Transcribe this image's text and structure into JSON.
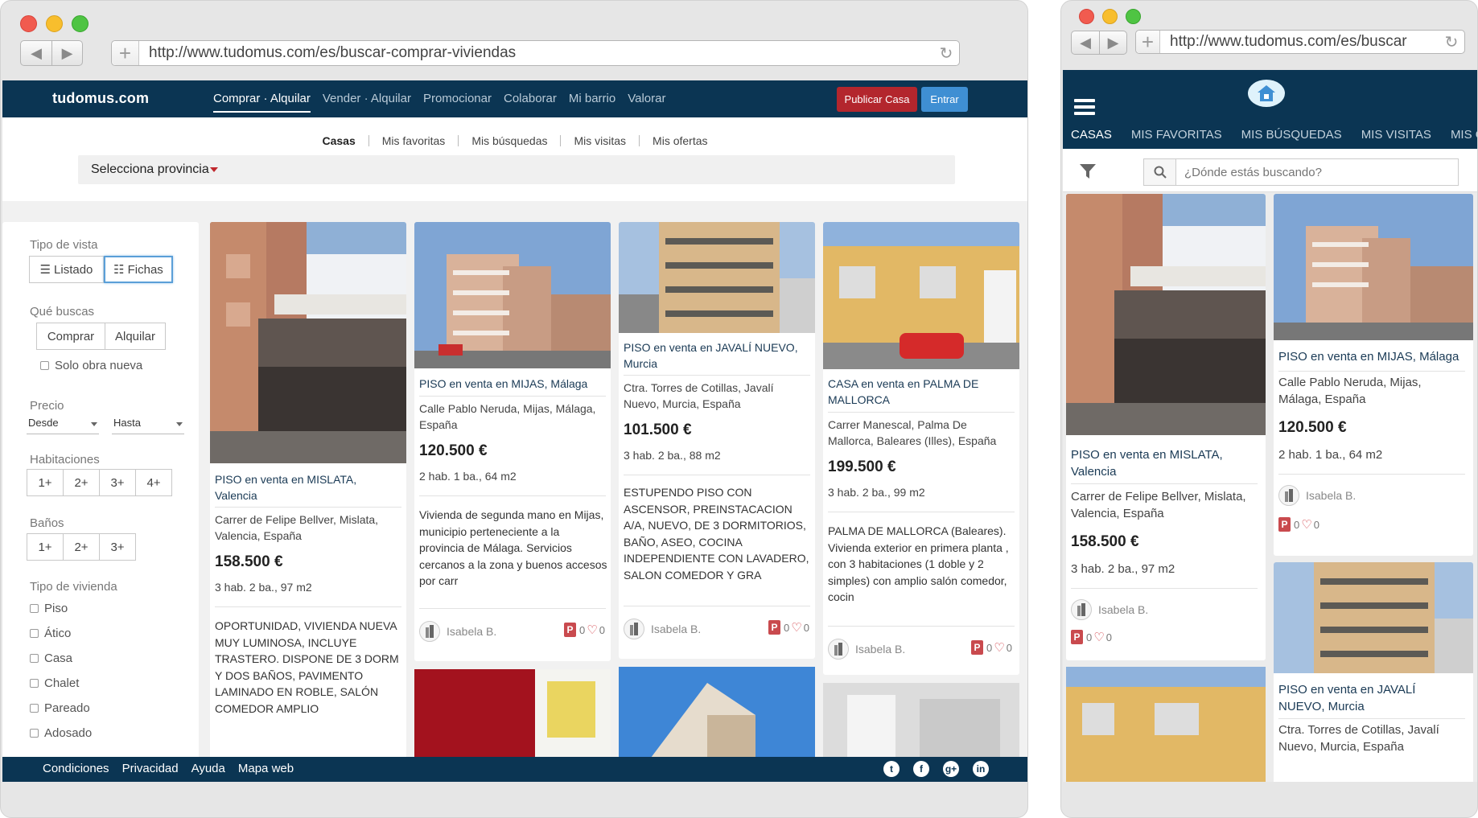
{
  "main_window": {
    "url": "http://www.tudomus.com/es/buscar-comprar-viviendas",
    "site": {
      "logo": "tudomus.com",
      "nav": [
        "Comprar · Alquilar",
        "Vender · Alquilar",
        "Promocionar",
        "Colaborar",
        "Mi barrio",
        "Valorar"
      ],
      "publish_label": "Publicar Casa",
      "login_label": "Entrar",
      "subnav": [
        "Casas",
        "Mis favoritas",
        "Mis búsquedas",
        "Mis visitas",
        "Mis ofertas"
      ],
      "province_label": "Selecciona provincia"
    },
    "filters": {
      "view_type_title": "Tipo de vista",
      "view_list": "Listado",
      "view_cards": "Fichas",
      "looking_title": "Qué buscas",
      "buy": "Comprar",
      "rent": "Alquilar",
      "new_only": "Solo obra nueva",
      "price_title": "Precio",
      "price_from": "Desde",
      "price_to": "Hasta",
      "rooms_title": "Habitaciones",
      "rooms": [
        "1+",
        "2+",
        "3+",
        "4+"
      ],
      "baths_title": "Baños",
      "baths": [
        "1+",
        "2+",
        "3+"
      ],
      "type_title": "Tipo de vivienda",
      "types": [
        "Piso",
        "Ático",
        "Casa",
        "Chalet",
        "Pareado",
        "Adosado"
      ]
    },
    "listings": [
      {
        "title": "PISO en venta en MISLATA, Valencia",
        "address": "Carrer de Felipe Bellver, Mislata, Valencia, España",
        "price": "158.500 €",
        "features": "3 hab. 2 ba., 97 m2",
        "description": "OPORTUNIDAD, VIVIENDA NUEVA MUY LUMINOSA, INCLUYE TRASTERO. DISPONE DE 3 DORM Y DOS BAÑOS, PAVIMENTO LAMINADO EN ROBLE, SALÓN COMEDOR AMPLIO"
      },
      {
        "title": "PISO en venta en MIJAS, Málaga",
        "address": "Calle Pablo Neruda, Mijas, Málaga, España",
        "price": "120.500 €",
        "features": "2 hab. 1 ba., 64 m2",
        "description": "Vivienda de segunda mano en Mijas, municipio perteneciente a la provincia de Málaga. Servicios cercanos a la zona y buenos accesos por carr",
        "agent": "Isabela B.",
        "badge": "P",
        "views": "0",
        "likes": "0"
      },
      {
        "title": "PISO en venta en JAVALÍ NUEVO, Murcia",
        "address": "Ctra. Torres de Cotillas, Javalí Nuevo, Murcia, España",
        "price": "101.500 €",
        "features": "3 hab. 2 ba., 88 m2",
        "description": "ESTUPENDO PISO CON ASCENSOR, PREINSTACACION A/A, NUEVO, DE 3 DORMITORIOS, BAÑO, ASEO, COCINA INDEPENDIENTE CON LAVADERO, SALON COMEDOR Y GRA",
        "agent": "Isabela B.",
        "badge": "P",
        "views": "0",
        "likes": "0"
      },
      {
        "title": "CASA en venta en PALMA DE MALLORCA",
        "address": "Carrer Manescal, Palma De Mallorca, Baleares (Illes), España",
        "price": "199.500 €",
        "features": "3 hab. 2 ba., 99 m2",
        "description": "PALMA DE MALLORCA (Baleares). Vivienda exterior en primera planta , con 3 habitaciones (1 doble y 2 simples) con amplio salón comedor, cocin",
        "agent": "Isabela B.",
        "badge": "P",
        "views": "0",
        "likes": "0"
      }
    ],
    "footer": {
      "links": [
        "Condiciones",
        "Privacidad",
        "Ayuda",
        "Mapa web"
      ],
      "social": [
        "twitter-icon",
        "facebook-icon",
        "google-plus-icon",
        "linkedin-icon"
      ]
    }
  },
  "mobile_window": {
    "url": "http://www.tudomus.com/es/buscar",
    "tabs": [
      "CASAS",
      "MIS FAVORITAS",
      "MIS BÚSQUEDAS",
      "MIS VISITAS",
      "MIS OI"
    ],
    "search_placeholder": "¿Dónde estás buscando?",
    "listings": [
      {
        "title": "PISO en venta en MISLATA, Valencia",
        "address": "Carrer de Felipe Bellver, Mislata, Valencia, España",
        "price": "158.500 €",
        "features": "3 hab. 2 ba., 97 m2",
        "agent": "Isabela B.",
        "badge": "P",
        "views": "0",
        "likes": "0"
      },
      {
        "title": "PISO en venta en MIJAS, Málaga",
        "address": "Calle Pablo Neruda, Mijas, Málaga, España",
        "price": "120.500 €",
        "features": "2 hab. 1 ba., 64 m2",
        "agent": "Isabela B.",
        "badge": "P",
        "views": "0",
        "likes": "0"
      },
      {
        "title": "PISO en venta en JAVALÍ NUEVO, Murcia",
        "address": "Ctra. Torres de Cotillas, Javalí Nuevo, Murcia, España"
      }
    ]
  },
  "colors": {
    "navy": "#0b3553",
    "red": "#b3262d",
    "blue": "#3f8fd3"
  }
}
